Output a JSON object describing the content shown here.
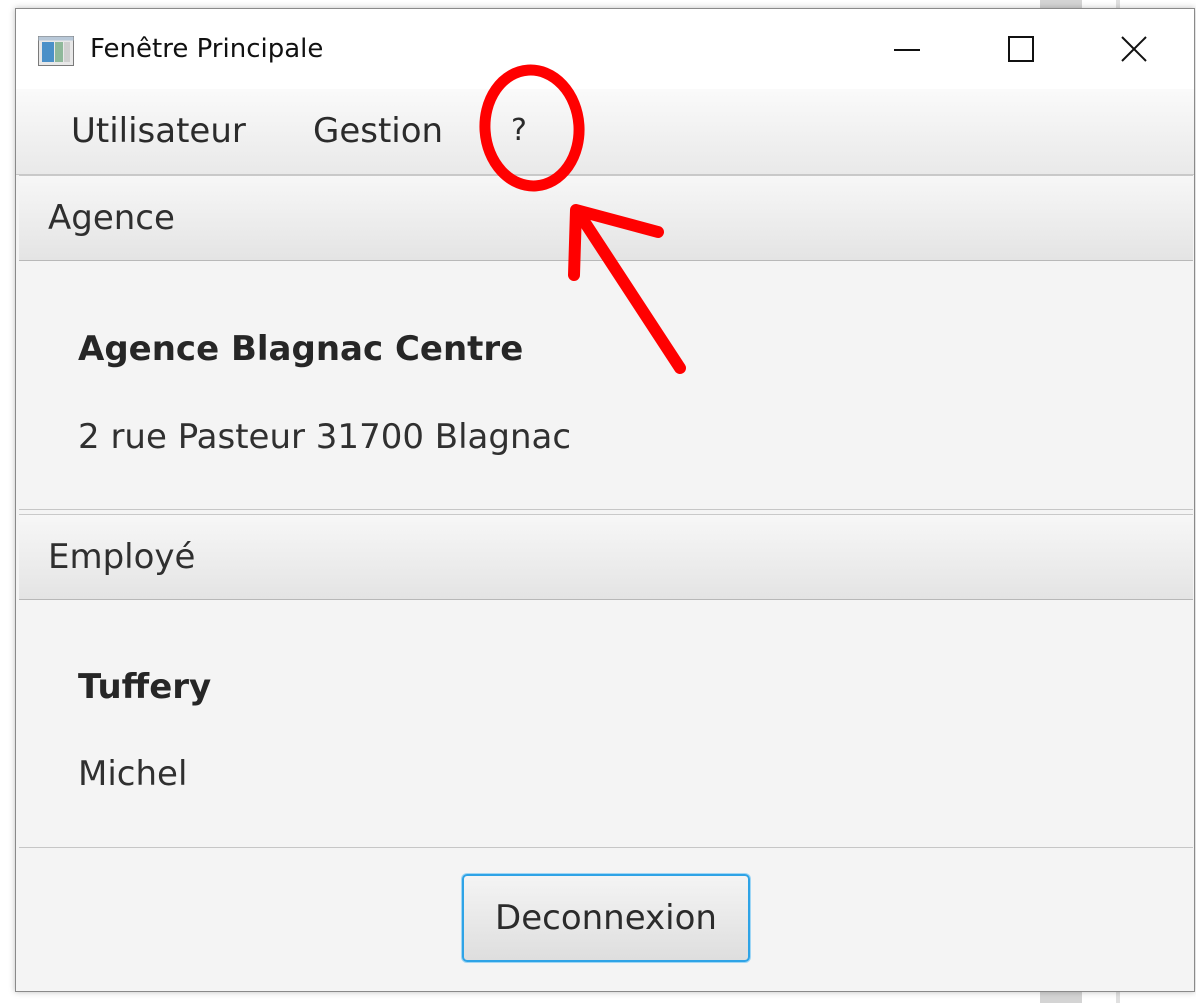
{
  "window": {
    "title": "Fenêtre Principale"
  },
  "menubar": {
    "items": [
      {
        "label": "Utilisateur"
      },
      {
        "label": "Gestion"
      },
      {
        "label": "?"
      }
    ]
  },
  "agence": {
    "header": "Agence",
    "name": "Agence Blagnac Centre",
    "address": "2 rue Pasteur 31700 Blagnac"
  },
  "employe": {
    "header": "Employé",
    "last_name": "Tuffery",
    "first_name": "Michel"
  },
  "footer": {
    "logout_label": "Deconnexion"
  },
  "colors": {
    "accent": "#2ea3e6",
    "annotation": "#ff0000"
  },
  "icons": {
    "app": "app-window-icon",
    "minimize": "minimize-icon",
    "maximize": "maximize-icon",
    "close": "close-icon"
  }
}
